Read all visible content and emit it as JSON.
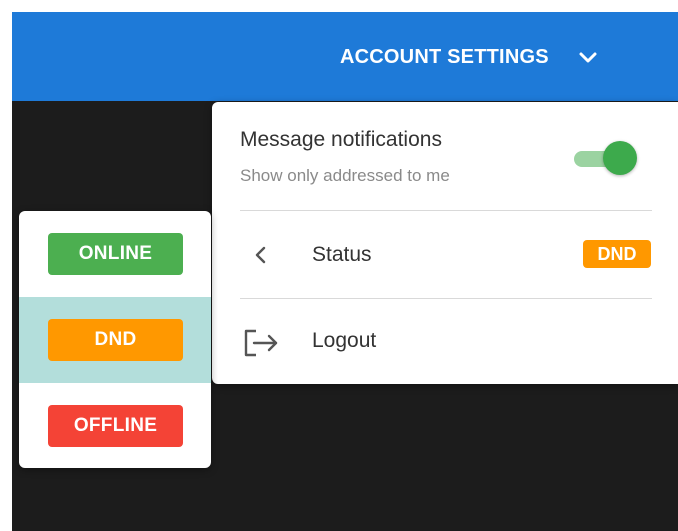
{
  "header": {
    "account_settings_label": "ACCOUNT SETTINGS",
    "chevron_icon": "chevron-down-icon"
  },
  "menu": {
    "notifications": {
      "title": "Message notifications",
      "subtitle": "Show only addressed to me",
      "toggle_on": true
    },
    "status": {
      "label": "Status",
      "badge": "DND",
      "icon": "chevron-left-icon"
    },
    "logout": {
      "label": "Logout",
      "icon": "logout-icon"
    }
  },
  "status_options": [
    {
      "label": "ONLINE",
      "color": "#4caf50",
      "selected": false
    },
    {
      "label": "DND",
      "color": "#ff9800",
      "selected": true
    },
    {
      "label": "OFFLINE",
      "color": "#f44336",
      "selected": false
    }
  ],
  "colors": {
    "header_bg": "#1e7ad8",
    "background": "#1c1c1c",
    "selected_bg": "#b3dedb",
    "toggle_on": "#3daa4c"
  }
}
